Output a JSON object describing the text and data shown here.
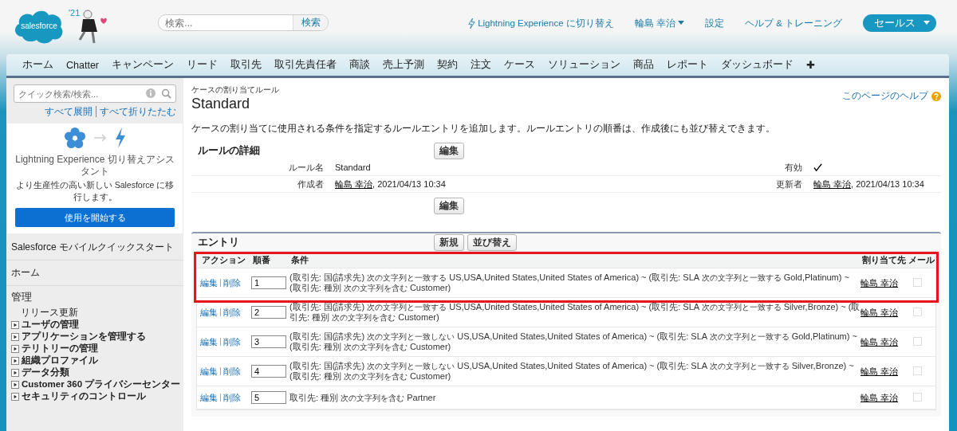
{
  "header": {
    "logo": "salesforce",
    "release": "'21",
    "search": {
      "placeholder": "検索...",
      "button": "検索"
    },
    "links": [
      {
        "kind": "lightning",
        "label": "Lightning Experience に切り替え"
      },
      {
        "kind": "user",
        "label": "輪島 幸治"
      },
      {
        "kind": "plain",
        "label": "設定"
      },
      {
        "kind": "plain",
        "label": "ヘルプ & トレーニング"
      }
    ],
    "app_menu": "セールス"
  },
  "tabs": [
    "ホーム",
    "Chatter",
    "キャンペーン",
    "リード",
    "取引先",
    "取引先責任者",
    "商談",
    "売上予測",
    "契約",
    "注文",
    "ケース",
    "ソリューション",
    "商品",
    "レポート",
    "ダッシュボード",
    "✚"
  ],
  "sidebar": {
    "search": {
      "placeholder": "クイック検索/検索..."
    },
    "expand_all": "すべて展開",
    "collapse_all": "すべて折りたたむ",
    "promo": {
      "title": "Lightning Experience 切り替えアシスタント",
      "text": "より生産性の高い新しい Salesforce に移行します。",
      "button": "使用を開始する"
    },
    "sections": [
      "Salesforce モバイルクイックスタート",
      "ホーム"
    ],
    "admin": {
      "title": "管理",
      "items": [
        {
          "kind": "link",
          "label": "リリース更新"
        },
        {
          "kind": "folder",
          "label": "ユーザの管理",
          "expanded": false
        },
        {
          "kind": "folder",
          "label": "アプリケーションを管理する",
          "expanded": false
        },
        {
          "kind": "folder",
          "label": "テリトリーの管理",
          "expanded": false
        },
        {
          "kind": "folder",
          "label": "組織プロファイル",
          "expanded": false
        },
        {
          "kind": "folder",
          "label": "データ分類",
          "expanded": false
        },
        {
          "kind": "folder",
          "label": "Customer 360 プライバシーセンター",
          "expanded": false
        },
        {
          "kind": "folder",
          "label": "セキュリティのコントロール",
          "expanded": false
        }
      ]
    }
  },
  "page": {
    "breadcrumb": "ケースの割り当てルール",
    "title": "Standard",
    "help": "このページのヘルプ",
    "description": "ケースの割り当てに使用される条件を指定するルールエントリを追加します。ルールエントリの順番は、作成後にも並び替えできます。",
    "detail": {
      "title": "ルールの詳細",
      "button": "編集",
      "bottom_button": "編集",
      "rule_name_label": "ルール名",
      "rule_name": "Standard",
      "active_label": "有効",
      "active": true,
      "created_label": "作成者",
      "created_by": "輪島 幸治",
      "created_at": ", 2021/04/13 10:34",
      "modified_label": "更新者",
      "modified_by": "輪島 幸治",
      "modified_at": ", 2021/04/13 10:34"
    },
    "entries": {
      "title": "エントリ",
      "buttons": [
        "新規",
        "並び替え"
      ],
      "columns": [
        "アクション",
        "順番",
        "条件",
        "割り当て先",
        "メール"
      ],
      "header_highlighted": true,
      "rows": [
        {
          "actions": [
            "編集",
            "削除"
          ],
          "order": "1",
          "highlighted": true,
          "assignee": "輪島 幸治",
          "email": false,
          "condition": [
            {
              "kind": "text",
              "text": "(取引先: 国(請求先)"
            },
            {
              "kind": "op",
              "text": "次の文字列と一致する"
            },
            {
              "kind": "text",
              "text": "US,USA,United States,United States of America) ~ (取引先: SLA"
            },
            {
              "kind": "op",
              "text": "次の文字列と一致する"
            },
            {
              "kind": "text",
              "text": "Gold,Platinum) ~ (取引先: 種別"
            },
            {
              "kind": "op",
              "text": "次の文字列を含む"
            },
            {
              "kind": "text",
              "text": "Customer)"
            }
          ]
        },
        {
          "actions": [
            "編集",
            "削除"
          ],
          "order": "2",
          "highlighted": false,
          "assignee": "輪島 幸治",
          "email": false,
          "condition": [
            {
              "kind": "text",
              "text": "(取引先: 国(請求先)"
            },
            {
              "kind": "op",
              "text": "次の文字列と一致する"
            },
            {
              "kind": "text",
              "text": "US,USA,United States,United States of America) ~ (取引先: SLA"
            },
            {
              "kind": "op",
              "text": "次の文字列と一致する"
            },
            {
              "kind": "text",
              "text": "Silver,Bronze) ~ (取引先: 種別"
            },
            {
              "kind": "op",
              "text": "次の文字列を含む"
            },
            {
              "kind": "text",
              "text": "Customer)"
            }
          ]
        },
        {
          "actions": [
            "編集",
            "削除"
          ],
          "order": "3",
          "highlighted": false,
          "assignee": "輪島 幸治",
          "email": false,
          "condition": [
            {
              "kind": "text",
              "text": "(取引先: 国(請求先)"
            },
            {
              "kind": "op",
              "text": "次の文字列と一致しない"
            },
            {
              "kind": "text",
              "text": "US,USA,United States,United States of America) ~ (取引先: SLA"
            },
            {
              "kind": "op",
              "text": "次の文字列と一致する"
            },
            {
              "kind": "text",
              "text": "Gold,Platinum) ~ (取引先: 種別"
            },
            {
              "kind": "op",
              "text": "次の文字列を含む"
            },
            {
              "kind": "text",
              "text": "Customer)"
            }
          ]
        },
        {
          "actions": [
            "編集",
            "削除"
          ],
          "order": "4",
          "highlighted": false,
          "assignee": "輪島 幸治",
          "email": false,
          "condition": [
            {
              "kind": "text",
              "text": "(取引先: 国(請求先)"
            },
            {
              "kind": "op",
              "text": "次の文字列と一致しない"
            },
            {
              "kind": "text",
              "text": "US,USA,United States,United States of America) ~ (取引先: SLA"
            },
            {
              "kind": "op",
              "text": "次の文字列と一致する"
            },
            {
              "kind": "text",
              "text": "Silver,Bronze) ~ (取引先: 種別"
            },
            {
              "kind": "op",
              "text": "次の文字列を含む"
            },
            {
              "kind": "text",
              "text": "Customer)"
            }
          ]
        },
        {
          "actions": [
            "編集",
            "削除"
          ],
          "order": "5",
          "highlighted": false,
          "assignee": "輪島 幸治",
          "email": false,
          "condition": [
            {
              "kind": "text",
              "text": "取引先: 種別"
            },
            {
              "kind": "op",
              "text": "次の文字列を含む"
            },
            {
              "kind": "text",
              "text": "Partner"
            }
          ]
        }
      ]
    }
  }
}
